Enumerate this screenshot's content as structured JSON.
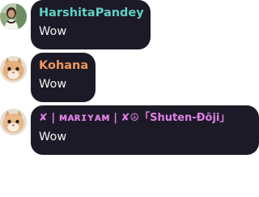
{
  "messages": [
    {
      "username": "HarshitaPandey",
      "username_color": "#5fd1c4",
      "text": "Wow",
      "avatar": "woman-photo-avatar"
    },
    {
      "username": "Kohana",
      "username_color": "#f0975f",
      "text": "Wow",
      "avatar": "cat-photo-avatar"
    },
    {
      "username": "✘ | ᴍᴀʀɪʏᴀᴍ | ✘☮「Shuten-Ðōji」",
      "username_color": "#e07ee6",
      "text": "Wow",
      "avatar": "cat-photo-avatar"
    }
  ]
}
